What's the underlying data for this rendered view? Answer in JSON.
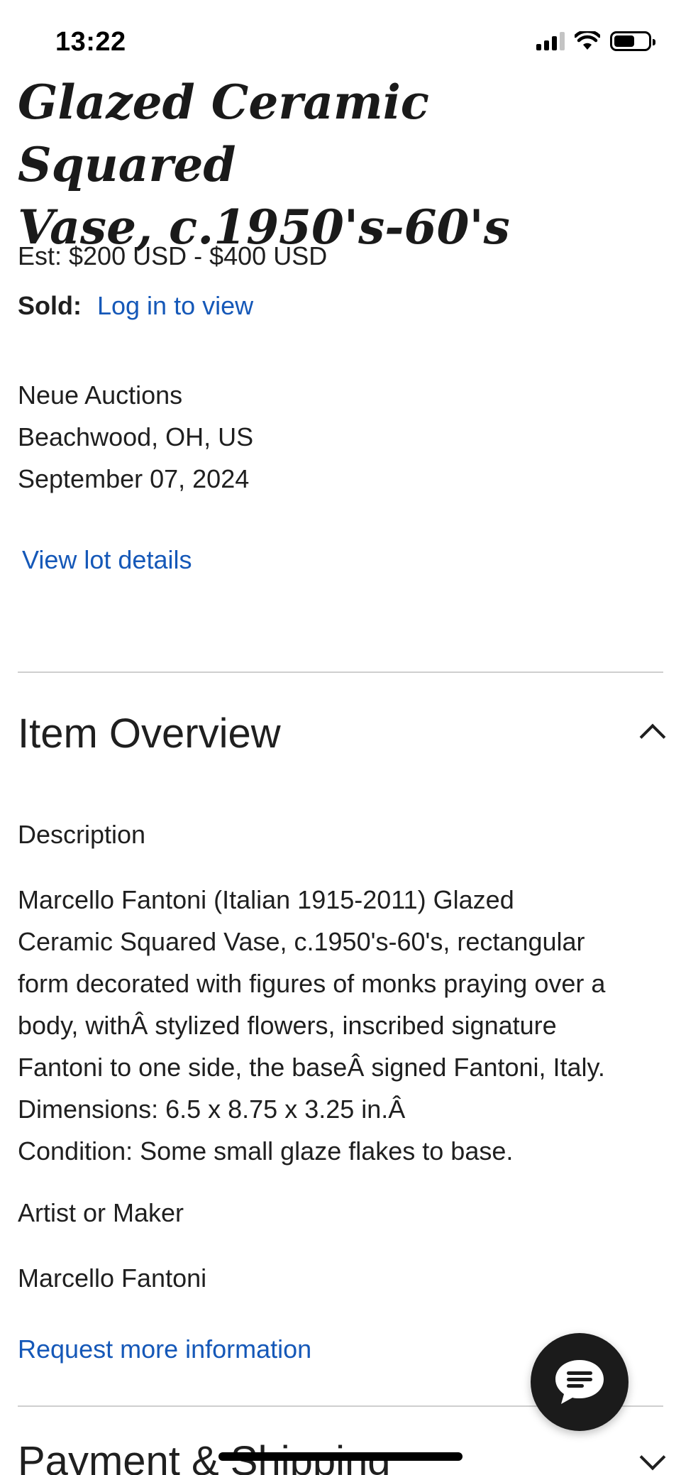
{
  "status_bar": {
    "time": "13:22"
  },
  "lot": {
    "title_line1": "Glazed Ceramic Squared",
    "title_line2": "Vase, c.1950's-60's",
    "estimate": "Est: $200 USD - $400 USD",
    "sold_label": "Sold:",
    "sold_link": "Log in to view",
    "auction_house": "Neue Auctions",
    "location": "Beachwood, OH, US",
    "date": "September 07, 2024",
    "view_details_link": "View lot details"
  },
  "item_overview": {
    "heading": "Item Overview",
    "description_label": "Description",
    "description": "Marcello Fantoni (Italian 1915-2011) Glazed\nCeramic Squared Vase, c.1950's-60's, rectangular\nform decorated with figures of monks praying over a\nbody, withÂ stylized flowers, inscribed signature\nFantoni to one side, the baseÂ signed Fantoni, Italy.\nDimensions: 6.5 x 8.75 x 3.25 in.Â\nCondition: Some small glaze flakes to base.",
    "artist_label": "Artist or Maker",
    "artist_name": "Marcello Fantoni",
    "request_link": "Request more information"
  },
  "payment_shipping": {
    "heading": "Payment & Shipping"
  },
  "icons": {
    "chat": "chat-bubble-icon",
    "collapse": "chevron-up-icon",
    "expand": "chevron-down-icon"
  },
  "colors": {
    "link": "#1558b8",
    "fab": "#1b1b1b"
  }
}
